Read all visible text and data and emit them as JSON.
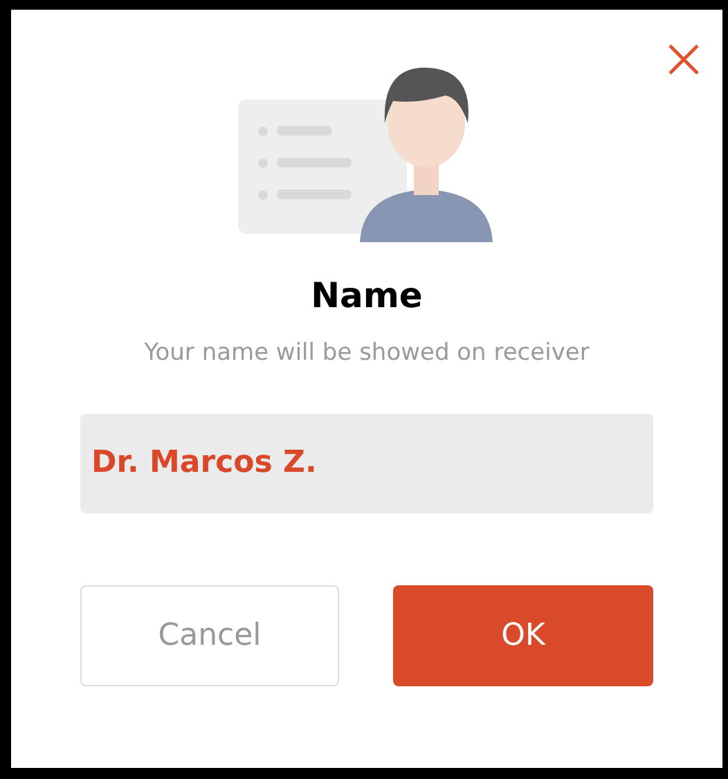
{
  "dialog": {
    "title": "Name",
    "subtitle": "Your name will be showed on receiver",
    "name_field": {
      "value": "Dr. Marcos Z."
    },
    "buttons": [
      {
        "label": "Cancel",
        "kind": "secondary"
      },
      {
        "label": "OK",
        "kind": "primary"
      }
    ]
  }
}
